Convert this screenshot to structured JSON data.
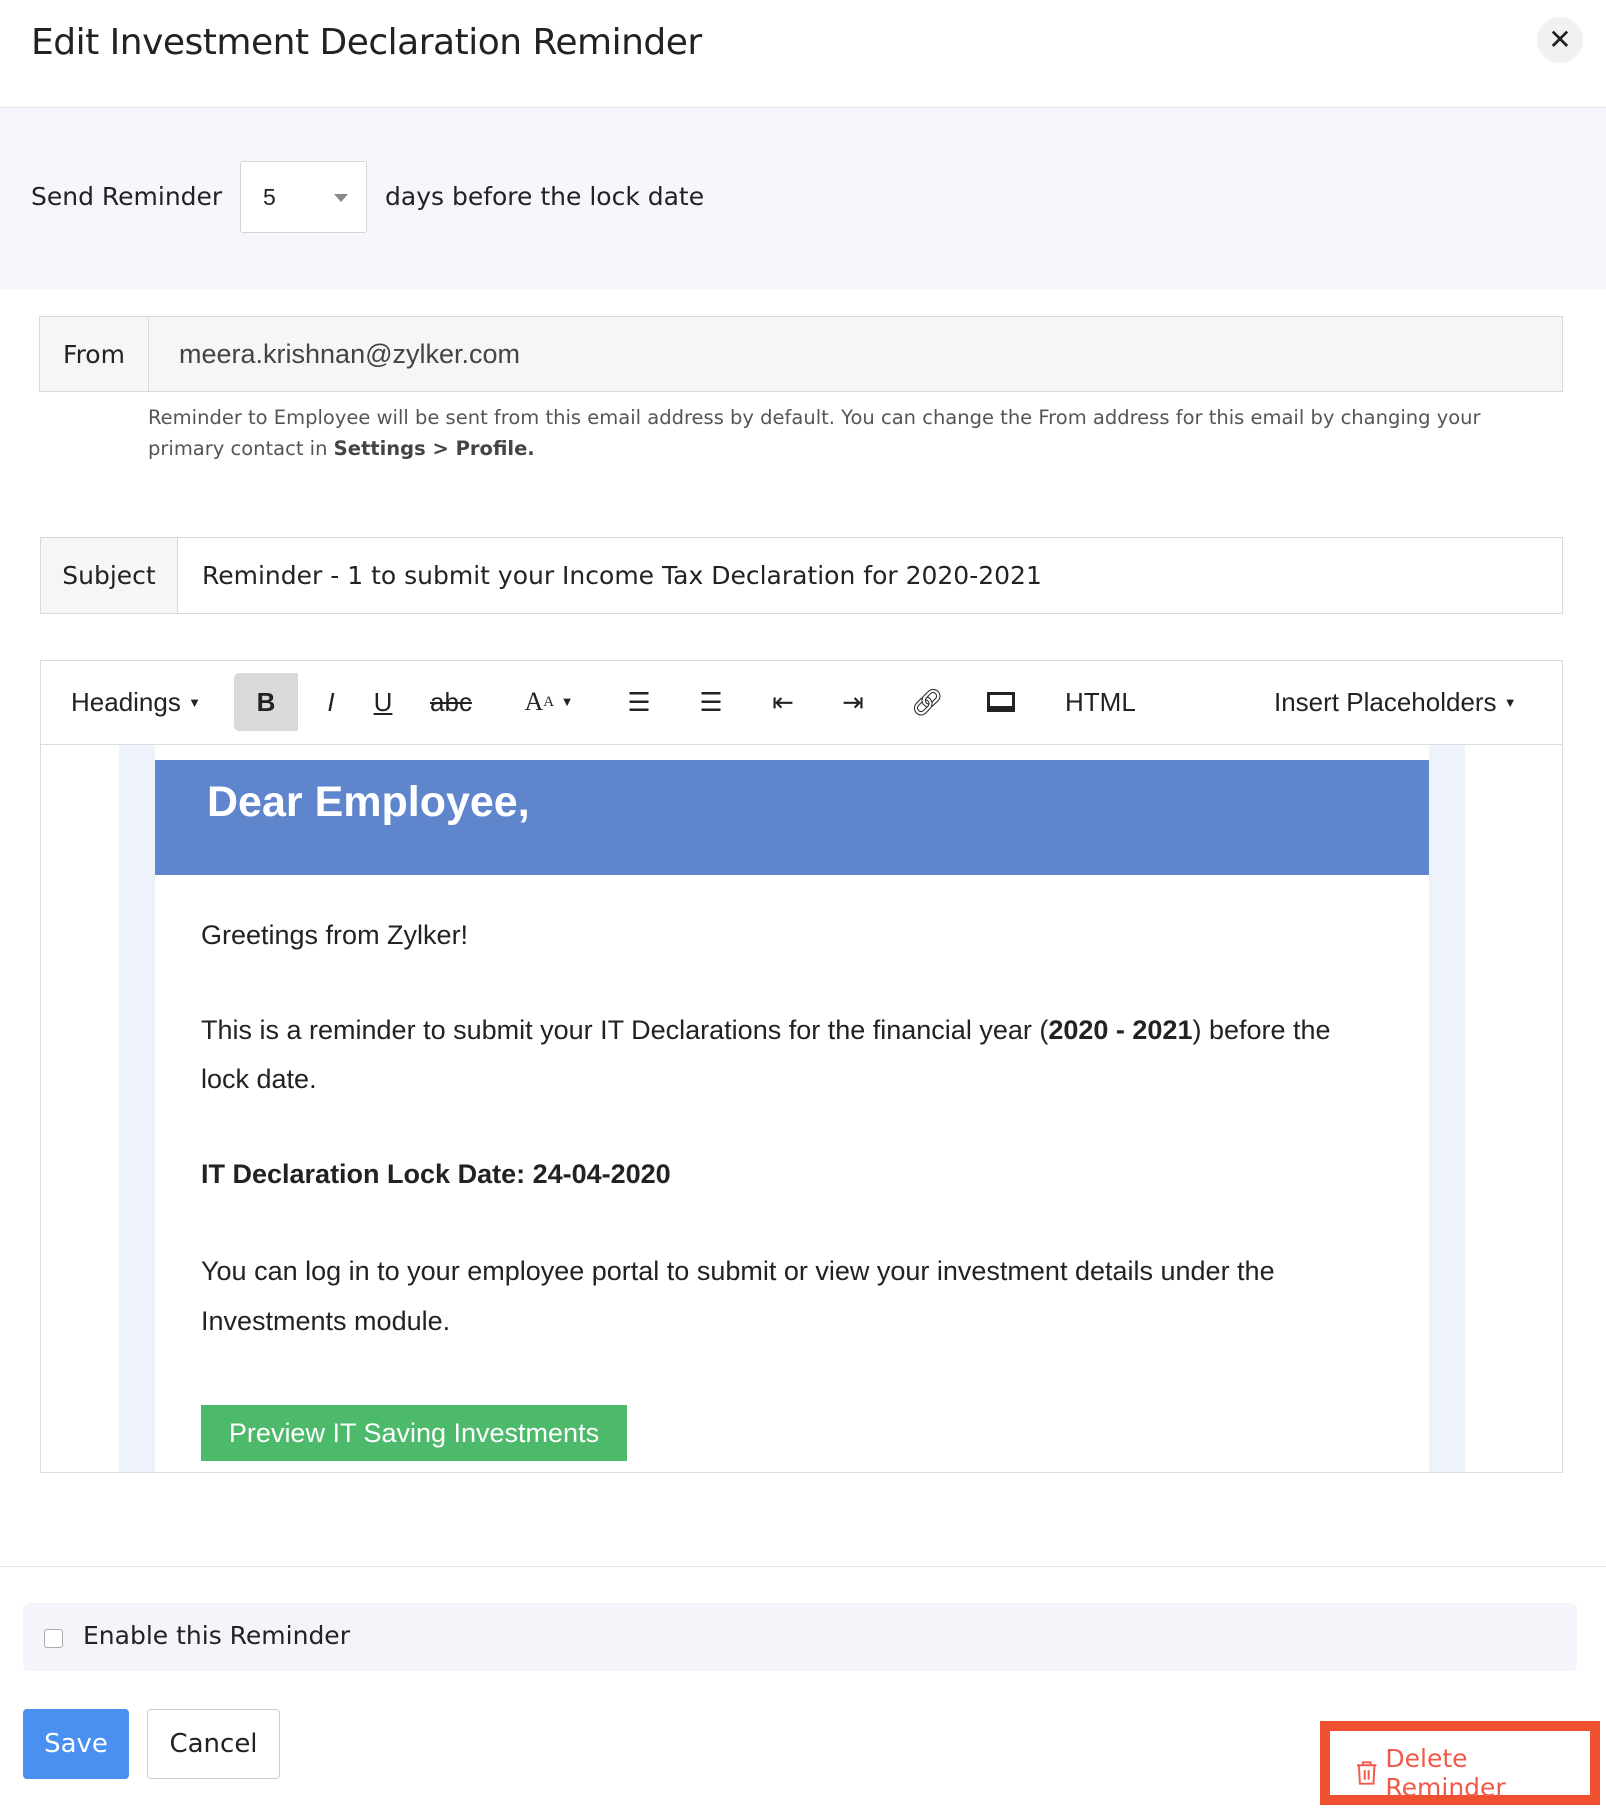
{
  "dialog": {
    "title": "Edit Investment Declaration Reminder",
    "close_icon": "close-icon"
  },
  "reminder": {
    "prefix": "Send Reminder",
    "days": "5",
    "suffix": "days before the lock date"
  },
  "from": {
    "label": "From",
    "value": "meera.krishnan@zylker.com",
    "help_text": "Reminder to Employee will be sent from this email address by default. You can change the From address for this email by changing your primary contact in ",
    "help_link": "Settings > Profile."
  },
  "subject": {
    "label": "Subject",
    "value": "Reminder - 1 to submit your Income Tax Declaration for 2020-2021"
  },
  "toolbar": {
    "headings": "Headings",
    "bold": "B",
    "italic": "I",
    "underline": "U",
    "strike": "abc",
    "font_size": "A",
    "html": "HTML",
    "placeholders": "Insert Placeholders"
  },
  "email": {
    "heading": "Dear Employee,",
    "greeting": "Greetings from Zylker!",
    "para1_a": "This is a reminder to submit your IT Declarations for the financial year (",
    "para1_b": "2020 - 2021",
    "para1_c": ") before the",
    "para1_d": "lock date.",
    "lock_date": "IT Declaration Lock Date: 24-04-2020",
    "para2_a": "You can log in to your employee portal to submit or view your investment details under the",
    "para2_b": "Investments module.",
    "button": "Preview IT Saving Investments",
    "header_color": "#5f86cd",
    "button_color": "#4cb96b"
  },
  "enable": {
    "label": "Enable this Reminder",
    "checked": false
  },
  "actions": {
    "save": "Save",
    "cancel": "Cancel",
    "delete": "Delete Reminder"
  },
  "colors": {
    "primary": "#4a90f0",
    "danger": "#f05a4a",
    "highlight": "#ef5130"
  }
}
